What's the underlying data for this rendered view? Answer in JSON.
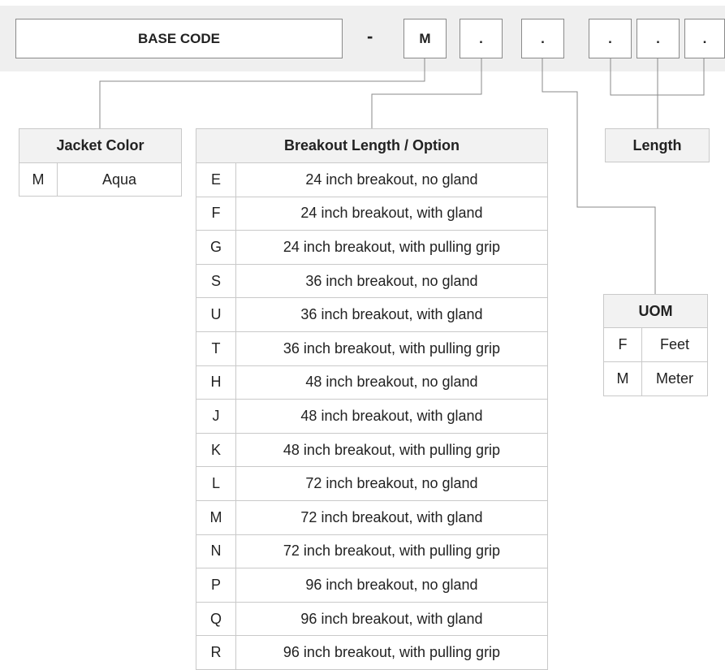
{
  "part_number": {
    "base_code": "BASE  CODE",
    "separator": "-",
    "slots": [
      "M",
      ".",
      ".",
      ".",
      ".",
      "."
    ]
  },
  "jacket_color": {
    "title": "Jacket Color",
    "rows": [
      {
        "code": "M",
        "desc": "Aqua"
      }
    ]
  },
  "breakout": {
    "title": "Breakout Length / Option",
    "rows": [
      {
        "code": "E",
        "desc": "24 inch breakout, no gland"
      },
      {
        "code": "F",
        "desc": "24 inch breakout, with gland"
      },
      {
        "code": "G",
        "desc": "24 inch breakout, with pulling grip"
      },
      {
        "code": "S",
        "desc": "36 inch breakout, no gland"
      },
      {
        "code": "U",
        "desc": "36 inch breakout, with gland"
      },
      {
        "code": "T",
        "desc": "36 inch breakout, with pulling grip"
      },
      {
        "code": "H",
        "desc": "48 inch breakout, no gland"
      },
      {
        "code": "J",
        "desc": "48 inch breakout, with gland"
      },
      {
        "code": "K",
        "desc": "48 inch breakout, with pulling grip"
      },
      {
        "code": "L",
        "desc": "72 inch breakout, no gland"
      },
      {
        "code": "M",
        "desc": "72 inch breakout, with gland"
      },
      {
        "code": "N",
        "desc": "72 inch breakout, with pulling grip"
      },
      {
        "code": "P",
        "desc": "96 inch breakout, no gland"
      },
      {
        "code": "Q",
        "desc": "96 inch breakout, with gland"
      },
      {
        "code": "R",
        "desc": "96 inch breakout, with pulling grip"
      }
    ]
  },
  "length": {
    "title": "Length"
  },
  "uom": {
    "title": "UOM",
    "rows": [
      {
        "code": "F",
        "desc": "Feet"
      },
      {
        "code": "M",
        "desc": "Meter"
      }
    ]
  },
  "colors": {
    "band": "#efefef",
    "header": "#f2f2f2",
    "line": "#8a8a8a",
    "grid": "#c9c9c9"
  }
}
